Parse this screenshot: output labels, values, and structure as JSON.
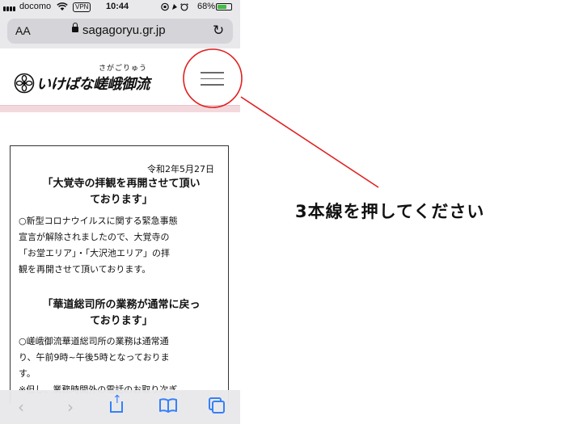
{
  "status_bar": {
    "carrier": "docomo",
    "vpn_label": "VPN",
    "time": "10:44",
    "battery_label": "68%",
    "battery_level": 0.68
  },
  "url_bar": {
    "text_size_label": "AA",
    "url": "sagagoryu.gr.jp"
  },
  "site_header": {
    "logo_ruby": "さがごりゅう",
    "logo_text": "いけばな嵯峨御流"
  },
  "notice": {
    "date": "令和2年5月27日",
    "heading1_line1": "「大覚寺の拝観を再開させて頂い",
    "heading1_line2": "ております」",
    "body1_line1": "○新型コロナウイルスに関する緊急事態",
    "body1_line2": "宣言が解除されましたので、大覚寺の",
    "body1_line3": "「お堂エリア」・「大沢池エリア」の拝",
    "body1_line4": "観を再開させて頂いております。",
    "heading2_line1": "「華道総司所の業務が通常に戻っ",
    "heading2_line2": "ております」",
    "body2_line1": "○嵯峨御流華道総司所の業務は通常通",
    "body2_line2": "り、午前9時~午後5時となっておりま",
    "body2_line3": "す。",
    "body2_line4": "※但し、業務時間外の電話のお取り次ぎ"
  },
  "annotation": {
    "instruction": "3本線を押してください",
    "color": "#e02020"
  },
  "colors": {
    "ios_blue": "#2e7cf6",
    "pink_band": "#f3d9dd"
  }
}
